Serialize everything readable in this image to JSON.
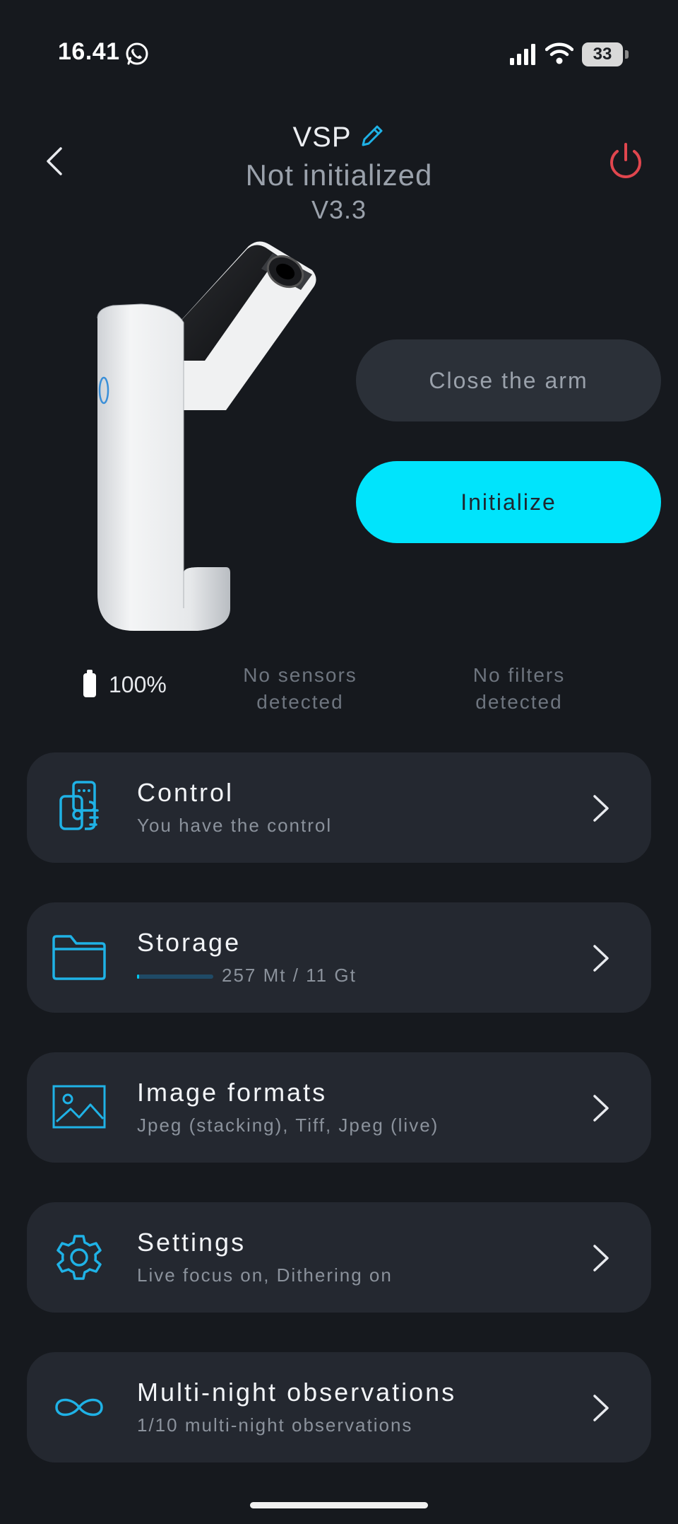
{
  "status_bar": {
    "time": "16.41",
    "battery_percent": "33"
  },
  "header": {
    "device_name": "VSP",
    "status": "Not initialized",
    "version": "V3.3"
  },
  "actions": {
    "close_arm_label": "Close the arm",
    "initialize_label": "Initialize"
  },
  "info": {
    "battery": "100%",
    "sensors": "No sensors detected",
    "filters": "No filters detected"
  },
  "menu": {
    "items": [
      {
        "title": "Control",
        "subtitle": "You have the control",
        "icon": "remote-control-icon"
      },
      {
        "title": "Storage",
        "subtitle": "257 Mt / 11 Gt",
        "icon": "folder-icon",
        "used_fraction": 0.023
      },
      {
        "title": "Image formats",
        "subtitle": "Jpeg (stacking), Tiff, Jpeg (live)",
        "icon": "image-icon"
      },
      {
        "title": "Settings",
        "subtitle": "Live focus on, Dithering on",
        "icon": "gear-icon"
      },
      {
        "title": "Multi-night observations",
        "subtitle": "1/10 multi-night observations",
        "icon": "infinity-icon"
      }
    ]
  },
  "colors": {
    "background": "#16191e",
    "card": "#242830",
    "accent": "#00e4fc",
    "icon_blue": "#1fb2e6",
    "power_red": "#e0464e"
  }
}
